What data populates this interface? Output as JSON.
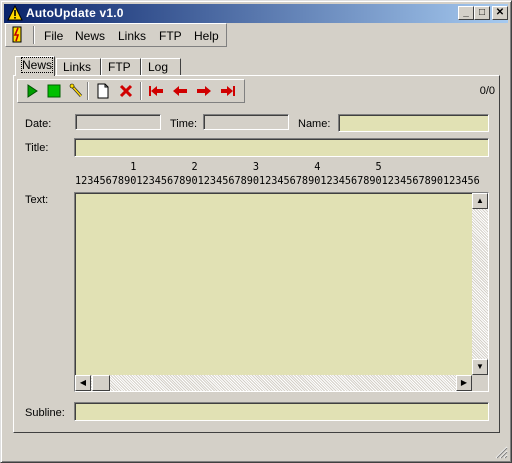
{
  "window": {
    "title": "AutoUpdate v1.0",
    "minimize": "_",
    "maximize": "□",
    "close": "✕"
  },
  "menu": [
    "File",
    "News",
    "Links",
    "FTP",
    "Help"
  ],
  "tabs": [
    "News",
    "Links",
    "FTP",
    "Log"
  ],
  "toolbar": {
    "icons": [
      "play-icon",
      "stop-icon",
      "wand-icon",
      "new-page-icon",
      "delete-icon",
      "first-icon",
      "prev-icon",
      "next-icon",
      "last-icon"
    ],
    "counter": "0/0"
  },
  "labels": {
    "date": "Date:",
    "time": "Time:",
    "name": "Name:",
    "title": "Title:",
    "text": "Text:",
    "subline": "Subline:"
  },
  "ruler": {
    "tens": "         1         2         3         4         5",
    "units": "123456789012345678901234567890123456789012345678901234567890123456"
  },
  "fields": {
    "date": "",
    "time": "",
    "name": "",
    "title": "",
    "text": "",
    "subline": ""
  },
  "colors": {
    "field_bg": "#e1e1b4",
    "titlebar_start": "#0a246a",
    "titlebar_end": "#a6caf0"
  }
}
